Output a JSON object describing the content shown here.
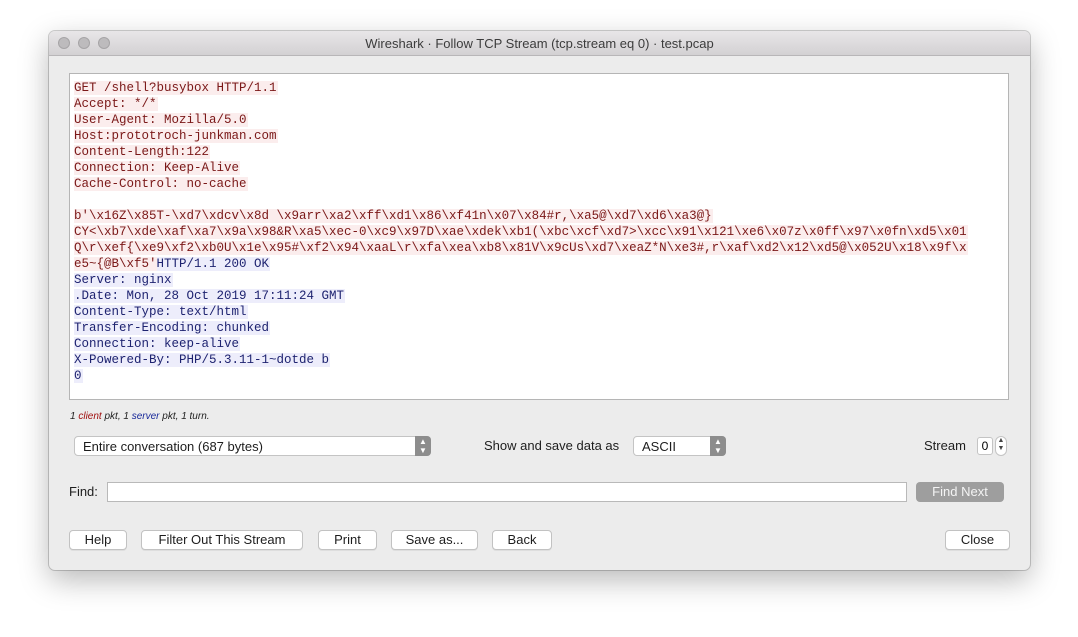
{
  "window": {
    "title": "Wireshark · Follow TCP Stream (tcp.stream eq 0) · test.pcap"
  },
  "stream": {
    "client_lines": [
      "GET /shell?busybox HTTP/1.1",
      "Accept: */*",
      "User-Agent: Mozilla/5.0",
      "Host:prototroch-junkman.com",
      "Content-Length:122",
      "Connection: Keep-Alive",
      "Cache-Control: no-cache",
      "",
      "b'\\x16Z\\x85T-\\xd7\\xdcv\\x8d \\x9arr\\xa2\\xff\\xd1\\x86\\xf41n\\x07\\x84#r,\\xa5@\\xd7\\xd6\\xa3@}",
      "CY<\\xb7\\xde\\xaf\\xa7\\x9a\\x98&R\\xa5\\xec-0\\xc9\\x97D\\xae\\xdek\\xb1(\\xbc\\xcf\\xd7>\\xcc\\x91\\x121\\xe6\\x07z\\x0ff\\x97\\x0fn\\xd5\\x01",
      "Q\\r\\xef{\\xe9\\xf2\\xb0U\\x1e\\x95#\\xf2\\x94\\xaaL\\r\\xfa\\xea\\xb8\\x81V\\x9cUs\\xd7\\xeaZ*N\\xe3#,r\\xaf\\xd2\\x12\\xd5@\\x052U\\x18\\x9f\\x"
    ],
    "mixed_line": {
      "client": "e5~{@B\\xf5'",
      "server": "HTTP/1.1 200 OK"
    },
    "server_lines": [
      "Server: nginx",
      ".Date: Mon, 28 Oct 2019 17:11:24 GMT",
      "Content-Type: text/html",
      "Transfer-Encoding: chunked",
      "Connection: keep-alive",
      "X-Powered-By: PHP/5.3.11-1~dotde b",
      "0"
    ]
  },
  "summary": {
    "pkt_client_count": "1",
    "client_word": "client",
    "pkt_mid": " pkt, 1 ",
    "server_word": "server",
    "pkt_tail": " pkt, 1 turn."
  },
  "controls": {
    "conversation_select": "Entire conversation (687 bytes)",
    "show_save_label": "Show and save data as",
    "format_select": "ASCII",
    "stream_label": "Stream",
    "stream_value": "0",
    "find_label": "Find:",
    "find_value": "",
    "find_next_label": "Find Next"
  },
  "buttons": {
    "help": "Help",
    "filter_out": "Filter Out This Stream",
    "print": "Print",
    "save_as": "Save as...",
    "back": "Back",
    "close": "Close"
  },
  "colors": {
    "client_text": "#7a1717",
    "client_bg": "#fbeded",
    "server_text": "#1e2370",
    "server_bg": "#ededfb"
  }
}
